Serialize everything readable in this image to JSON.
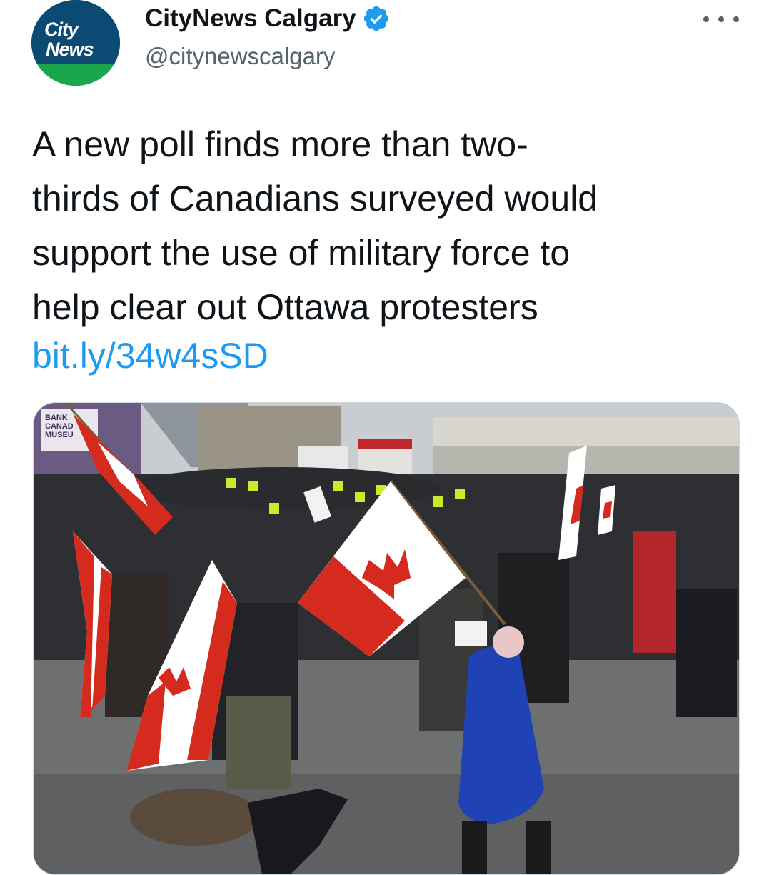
{
  "author": {
    "display_name": "CityNews Calgary",
    "handle": "@citynewscalgary",
    "verified": true,
    "avatar_logo": {
      "line1": "City",
      "line2": "News"
    }
  },
  "tweet": {
    "text": "A new poll finds more than two-\nthirds of Canadians surveyed would\nsupport the use of military force to\nhelp clear out Ottawa protesters",
    "link": "bit.ly/34w4sSD"
  },
  "media": {
    "sign_text": {
      "line1": "BANK",
      "line2": "CANAD",
      "line3": "MUSEU"
    }
  },
  "icons": {
    "verified": "verified-badge-icon",
    "more": "more-options-icon"
  },
  "colors": {
    "verified": "#1d9bf0",
    "link": "#1d9bf0",
    "handle": "#536471",
    "flag_red": "#d52b1e",
    "avatar_blue": "#0b4a73",
    "avatar_green": "#1aa64a"
  }
}
